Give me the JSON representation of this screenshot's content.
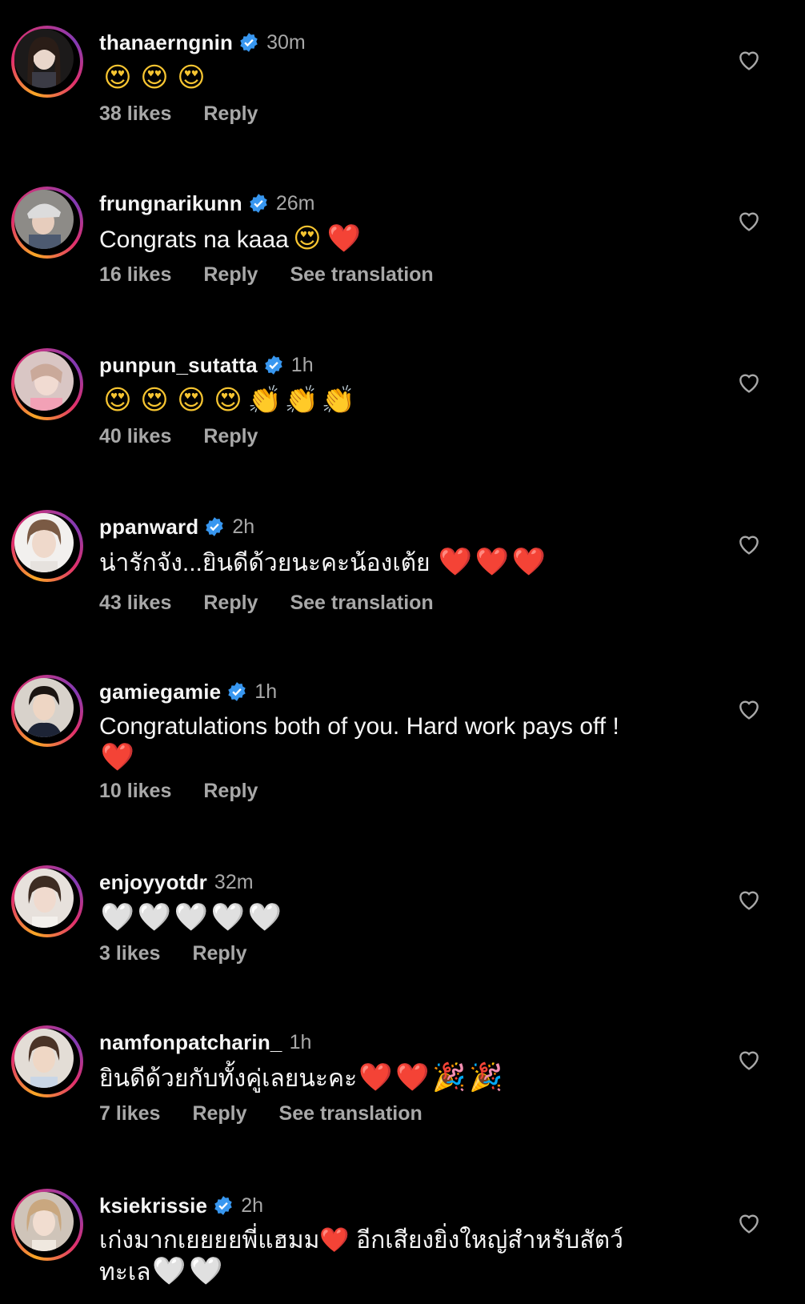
{
  "colors": {
    "background": "#000000",
    "username": "#f5f5f5",
    "secondary": "#a8a8a8",
    "verified": "#3897f0",
    "heart_red": "#e0245e"
  },
  "comments": [
    {
      "username": "thanaerngnin",
      "verified": true,
      "time": "30m",
      "text": "",
      "emojis": [
        "😍",
        "😍",
        "😍"
      ],
      "likes": "38 likes",
      "reply": "Reply",
      "see_translation": ""
    },
    {
      "username": "frungnarikunn",
      "verified": true,
      "time": "26m",
      "text": "Congrats na kaaa",
      "emojis": [
        "😍",
        "❤️"
      ],
      "likes": "16 likes",
      "reply": "Reply",
      "see_translation": "See translation"
    },
    {
      "username": "punpun_sutatta",
      "verified": true,
      "time": "1h",
      "text": "",
      "emojis": [
        "😍",
        "😍",
        "😍",
        "😍",
        "👏",
        "👏",
        "👏"
      ],
      "likes": "40 likes",
      "reply": "Reply",
      "see_translation": ""
    },
    {
      "username": "ppanward",
      "verified": true,
      "time": "2h",
      "text": "น่ารักจัง...ยินดีด้วยนะคะน้องเต้ย ",
      "emojis": [
        "❤️",
        "❤️",
        "❤️"
      ],
      "likes": "43 likes",
      "reply": "Reply",
      "see_translation": "See translation"
    },
    {
      "username": "gamiegamie",
      "verified": true,
      "time": "1h",
      "text": "Congratulations both of you. Hard work pays off !",
      "emojis": [
        "❤️"
      ],
      "likes": "10 likes",
      "reply": "Reply",
      "see_translation": ""
    },
    {
      "username": "enjoyyotdr",
      "verified": false,
      "time": "32m",
      "text": "",
      "emojis": [
        "🤍",
        "🤍",
        "🤍",
        "🤍",
        "🤍"
      ],
      "likes": "3 likes",
      "reply": "Reply",
      "see_translation": ""
    },
    {
      "username": "namfonpatcharin_",
      "verified": false,
      "time": "1h",
      "text": "ยินดีด้วยกับทั้งคู่เลยนะคะ",
      "emojis": [
        "❤️",
        "❤️",
        "🎉",
        "🎉"
      ],
      "likes": "7 likes",
      "reply": "Reply",
      "see_translation": "See translation"
    },
    {
      "username": "ksiekrissie",
      "verified": true,
      "time": "2h",
      "text": "เก่งมากเยยยยพี่แฮมม❤️ อีกเสียงยิ่งใหญ่สำหรับสัตว์ทะเล",
      "emojis": [
        "🤍",
        "🤍"
      ],
      "likes": "",
      "reply": "",
      "see_translation": ""
    }
  ]
}
